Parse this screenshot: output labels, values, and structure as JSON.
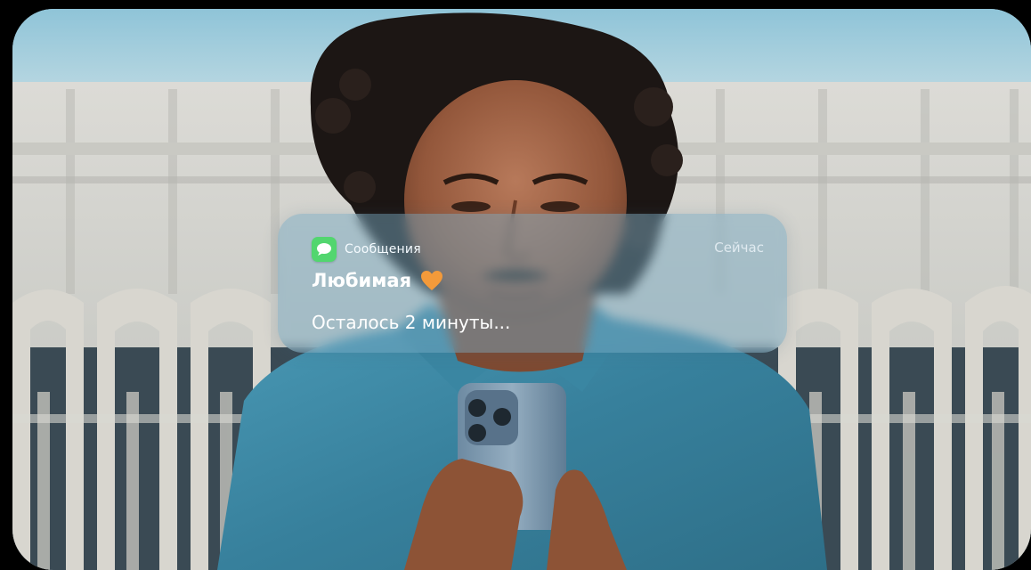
{
  "notification": {
    "app_icon": "messages-icon",
    "app_name": "Сообщения",
    "time": "Сейчас",
    "sender": "Любимая",
    "sender_emoji": "orange-heart-icon",
    "message": "Осталось 2 минуты..."
  },
  "colors": {
    "notification_bg": "#78aac3",
    "messages_green": "#52d66f",
    "heart_orange": "#f39a3a",
    "shirt_blue": "#3e8aa6"
  }
}
